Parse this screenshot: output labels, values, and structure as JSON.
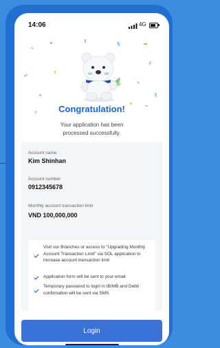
{
  "status_bar": {
    "time": "14:06",
    "network": "4G"
  },
  "success": {
    "title": "Congratulation!",
    "message": "Your application has been processed successfully."
  },
  "account": {
    "name_label": "Account name",
    "name_value": "Kim Shinhan",
    "number_label": "Account number",
    "number_value": "0912345678",
    "limit_label": "Monthly account transaction limit",
    "limit_value": "VND 100,000,000"
  },
  "notes": [
    "Visit our Branches or access to \"Upgrading Monthly Account Transaction Limit\" via SOL application to increase account transaction limit",
    "Application form will be sent to your email",
    "Temporary password to login in IB/MB and Debit confirmation will be sent via SMS"
  ],
  "login_button": "Login",
  "colors": {
    "accent": "#1c64c9",
    "button": "#3a73d5",
    "background": "#3b8de0"
  },
  "icons": [
    "signal-icon",
    "battery-icon",
    "check-icon",
    "mascot-illustration"
  ]
}
